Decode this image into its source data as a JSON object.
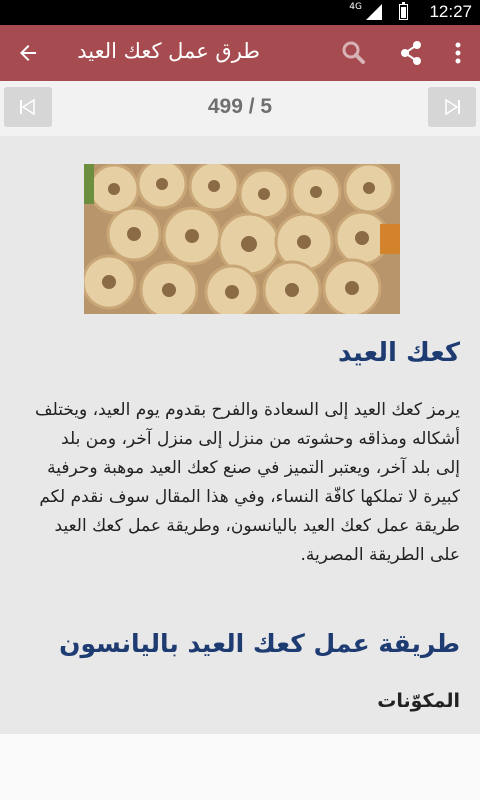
{
  "status_bar": {
    "time": "12:27",
    "network": "4G",
    "icons": [
      "signal-icon",
      "battery-icon"
    ]
  },
  "app_bar": {
    "title": "طرق عمل كعك العيد",
    "icons": [
      "back-arrow-icon",
      "search-icon",
      "share-icon",
      "more-vert-icon"
    ],
    "color": "#a64b4f"
  },
  "pager": {
    "counter": "499 / 5",
    "icons": [
      "first-page-icon",
      "last-page-icon"
    ]
  },
  "article": {
    "image_alt": "cookies-photo",
    "heading": "كعك العيد",
    "paragraph": "يرمز كعك العيد إلى السعادة والفرح بقدوم يوم العيد، ويختلف أشكاله ومذاقه وحشوته من منزل إلى منزل آخر، ومن بلد إلى بلد آخر، ويعتبر التميز في صنع كعك العيد موهبة وحرفية كبيرة لا تملكها كافّة النساء، وفي هذا المقال سوف نقدم لكم طريقة عمل كعك العيد باليانسون، وطريقة عمل كعك العيد على الطريقة المصرية.",
    "section_title": "طريقة عمل كعك العيد باليانسون",
    "subsection_title": "المكوّنات",
    "heading_color": "#1e3c72"
  }
}
